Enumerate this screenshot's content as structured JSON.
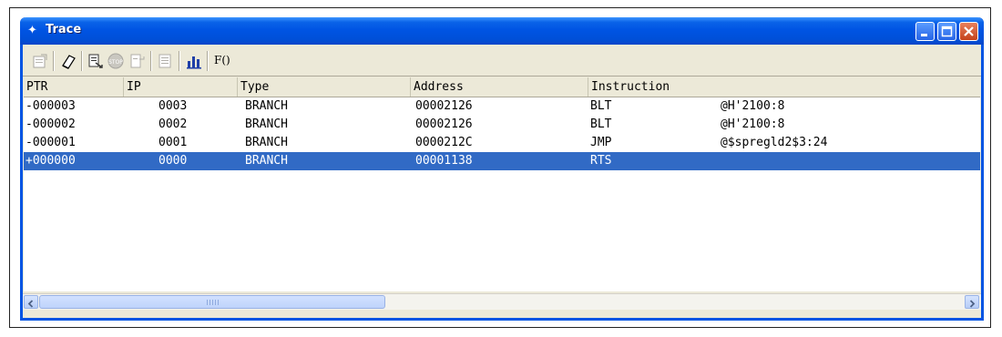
{
  "window": {
    "title": "Trace"
  },
  "toolbar": {
    "func_label": "F()"
  },
  "columns": [
    "PTR",
    "IP",
    "Type",
    "Address",
    "Instruction"
  ],
  "rows": [
    {
      "ptr": "-000003",
      "ip": "0003",
      "type": "BRANCH",
      "address": "00002126",
      "mnemonic": "BLT",
      "operand": "@H'2100:8"
    },
    {
      "ptr": "-000002",
      "ip": "0002",
      "type": "BRANCH",
      "address": "00002126",
      "mnemonic": "BLT",
      "operand": "@H'2100:8"
    },
    {
      "ptr": "-000001",
      "ip": "0001",
      "type": "BRANCH",
      "address": "0000212C",
      "mnemonic": "JMP",
      "operand": "@$spregld2$3:24"
    },
    {
      "ptr": "+000000",
      "ip": "0000",
      "type": "BRANCH",
      "address": "00001138",
      "mnemonic": "RTS",
      "operand": ""
    }
  ],
  "selected_row": 3,
  "colors": {
    "title_blue": "#0054e3",
    "selection": "#316ac5",
    "close_red": "#c4421c"
  }
}
